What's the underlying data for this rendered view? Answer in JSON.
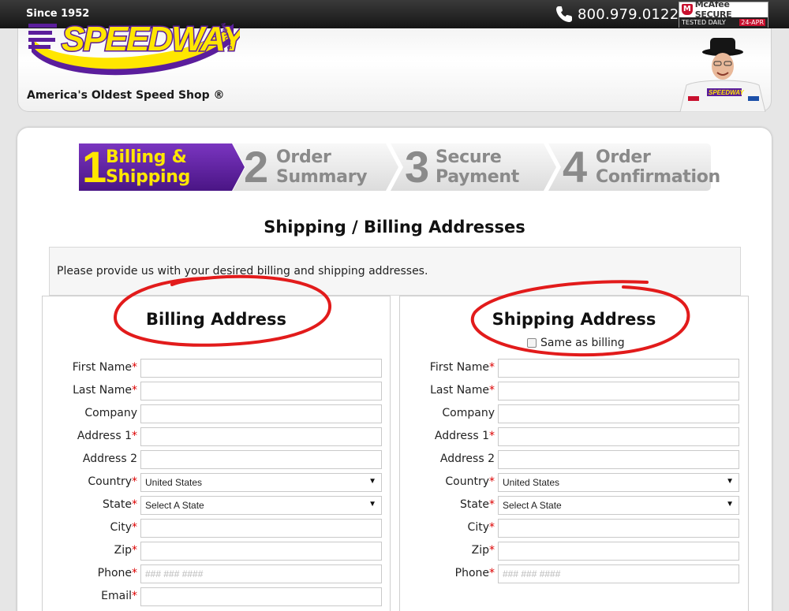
{
  "topbar": {
    "since": "Since 1952",
    "phone": "800.979.0122",
    "mcafee_brand": "McAfee SECURE",
    "mcafee_tested": "TESTED DAILY",
    "mcafee_date": "24-APR"
  },
  "header": {
    "logo_text": "SPEEDWAY",
    "logo_sub": "MOTORS",
    "tagline": "America's Oldest Speed Shop ®"
  },
  "steps": [
    {
      "num": "1",
      "line1": "Billing &",
      "line2": "Shipping",
      "active": true
    },
    {
      "num": "2",
      "line1": "Order",
      "line2": "Summary",
      "active": false
    },
    {
      "num": "3",
      "line1": "Secure",
      "line2": "Payment",
      "active": false
    },
    {
      "num": "4",
      "line1": "Order",
      "line2": "Confirmation",
      "active": false
    }
  ],
  "page_title": "Shipping / Billing Addresses",
  "intro": "Please provide us with your desired billing and shipping addresses.",
  "billing": {
    "title": "Billing Address",
    "fields": [
      {
        "label": "First Name",
        "required": "*",
        "value": "",
        "placeholder": ""
      },
      {
        "label": "Last Name",
        "required": "*",
        "value": "",
        "placeholder": ""
      },
      {
        "label": "Company",
        "required": "",
        "value": "",
        "placeholder": ""
      },
      {
        "label": "Address 1",
        "required": "*",
        "value": "",
        "placeholder": ""
      },
      {
        "label": "Address 2",
        "required": "",
        "value": "",
        "placeholder": ""
      },
      {
        "label": "Country",
        "required": "*",
        "value": "United States",
        "placeholder": ""
      },
      {
        "label": "State",
        "required": "*",
        "value": "Select A State",
        "placeholder": ""
      },
      {
        "label": "City",
        "required": "*",
        "value": "",
        "placeholder": ""
      },
      {
        "label": "Zip",
        "required": "*",
        "value": "",
        "placeholder": ""
      },
      {
        "label": "Phone",
        "required": "*",
        "value": "",
        "placeholder": "### ### ####"
      },
      {
        "label": "Email",
        "required": "*",
        "value": "",
        "placeholder": ""
      }
    ]
  },
  "shipping": {
    "title": "Shipping Address",
    "same_as_billing": "Same as billing",
    "same_checked": false,
    "fields": [
      {
        "label": "First Name",
        "required": "*",
        "value": "",
        "placeholder": ""
      },
      {
        "label": "Last Name",
        "required": "*",
        "value": "",
        "placeholder": ""
      },
      {
        "label": "Company",
        "required": "",
        "value": "",
        "placeholder": ""
      },
      {
        "label": "Address 1",
        "required": "*",
        "value": "",
        "placeholder": ""
      },
      {
        "label": "Address 2",
        "required": "",
        "value": "",
        "placeholder": ""
      },
      {
        "label": "Country",
        "required": "*",
        "value": "United States",
        "placeholder": ""
      },
      {
        "label": "State",
        "required": "*",
        "value": "Select A State",
        "placeholder": ""
      },
      {
        "label": "City",
        "required": "*",
        "value": "",
        "placeholder": ""
      },
      {
        "label": "Zip",
        "required": "*",
        "value": "",
        "placeholder": ""
      },
      {
        "label": "Phone",
        "required": "*",
        "value": "",
        "placeholder": "### ### ####"
      }
    ]
  },
  "colors": {
    "step_active": "#5b1e9c",
    "step_active_text": "#ffe600",
    "step_inactive": "#e4e4e4",
    "annotation_red": "#e21b1b",
    "required": "#dd0000"
  }
}
